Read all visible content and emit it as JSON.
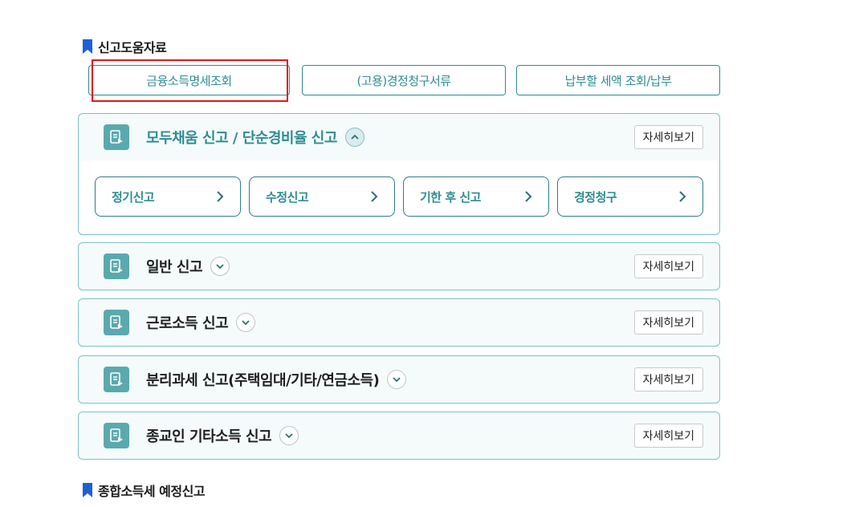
{
  "sections": [
    {
      "title": "신고도움자료"
    },
    {
      "title": "종합소득세 예정신고"
    }
  ],
  "help_buttons": [
    {
      "label": "금융소득명세조회"
    },
    {
      "label": "(고용)경정청구서류"
    },
    {
      "label": "납부할 세액 조회/납부"
    }
  ],
  "panels": [
    {
      "title": "모두채움 신고 / 단순경비율 신고",
      "detail_label": "자세히보기",
      "expanded": true,
      "sub_buttons": [
        {
          "label": "정기신고"
        },
        {
          "label": "수정신고"
        },
        {
          "label": "기한 후 신고"
        },
        {
          "label": "경정청구"
        }
      ]
    },
    {
      "title": "일반 신고",
      "detail_label": "자세히보기",
      "expanded": false
    },
    {
      "title": "근로소득 신고",
      "detail_label": "자세히보기",
      "expanded": false
    },
    {
      "title": "분리과세 신고(주택임대/기타/연금소득)",
      "detail_label": "자세히보기",
      "expanded": false
    },
    {
      "title": "종교인 기타소득 신고",
      "detail_label": "자세히보기",
      "expanded": false
    }
  ],
  "colors": {
    "accent": "#2f8c92",
    "bookmark": "#1f5fd6",
    "highlight_box": "#e0161d",
    "icon_bg": "#5aa9ae"
  },
  "icons": {
    "bookmark": "bookmark-icon",
    "document": "document-edit-icon",
    "expand": "chevron-down-icon",
    "collapse": "chevron-up-icon",
    "arrow": "chevron-right-icon"
  }
}
